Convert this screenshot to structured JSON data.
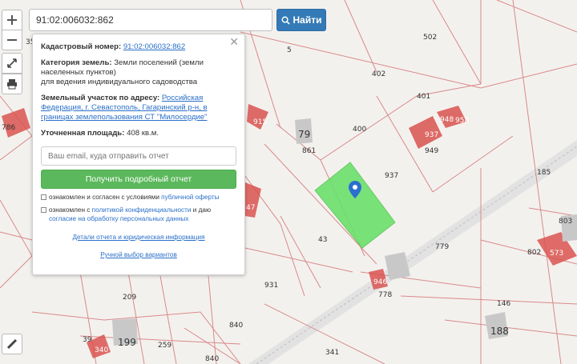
{
  "map": {
    "plot_labels": [
      "35",
      "786",
      "502",
      "5",
      "402",
      "401",
      "915",
      "79",
      "400",
      "937",
      "948",
      "958",
      "949",
      "861",
      "185",
      "47",
      "937",
      "43",
      "779",
      "803",
      "802",
      "573",
      "931",
      "778",
      "946",
      "209",
      "146",
      "840",
      "188",
      "39",
      "340",
      "199",
      "259",
      "341",
      "840"
    ],
    "pin_color": "#2b6fd0",
    "selected_plot_color": "#6be06b",
    "boundary_color": "#d88a8a"
  },
  "search": {
    "value": "91:02:006032:862",
    "button_label": "Найти"
  },
  "info": {
    "cadastral_label": "Кадастровый номер:",
    "cadastral_value": "91:02:006032:862",
    "category_label": "Категория земель:",
    "category_value": "Земли поселений (земли населенных пунктов)",
    "category_use": "для ведения индивидуального садоводства",
    "address_label": "Земельный участок по адресу:",
    "address_value": "Российская Федерация, г. Севастополь, Гагаринский р-н, в границах землепользования СТ \"Милосердие\"",
    "area_label": "Уточненная площадь:",
    "area_value": "408 кв.м.",
    "email_placeholder": "Ваш email, куда отправить отчет",
    "report_button": "Получить подробный отчет",
    "consent1_text": "ознакомлен и согласен с условиями",
    "consent1_link": "публичной оферты",
    "consent2_text": "ознакомлен с",
    "consent2_link": "политикой конфиденциальности",
    "consent2_text2": "и даю",
    "consent2_link2": "согласие на обработку персональных данных",
    "details_link": "Детали отчета и юридическая информация",
    "manual_link": "Ручной выбор вариантов"
  },
  "icons": {
    "close": "close-icon",
    "search": "search-icon",
    "zoom_in": "plus-icon",
    "zoom_out": "minus-icon",
    "fullscreen": "expand-icon",
    "print": "printer-icon",
    "ruler": "ruler-icon"
  }
}
